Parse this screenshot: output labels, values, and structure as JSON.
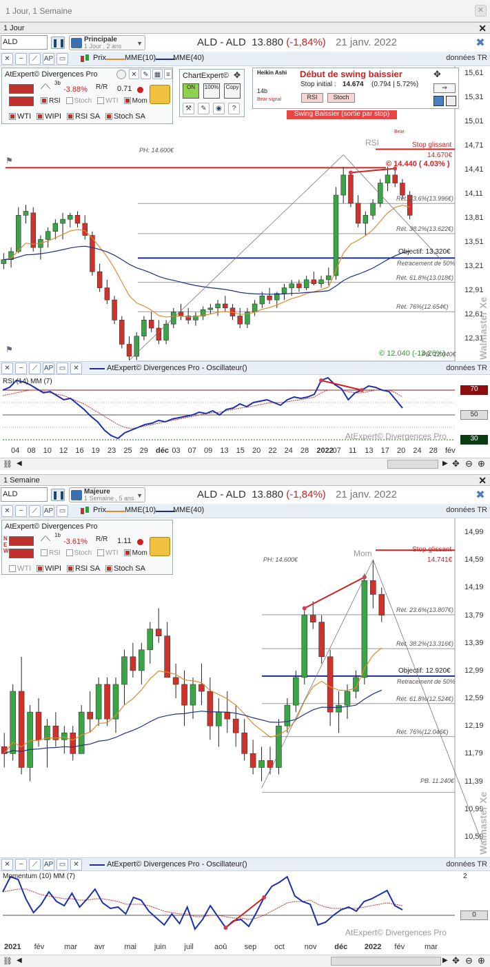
{
  "window": {
    "tab_title": "1 Jour, 1 Semaine"
  },
  "common": {
    "ticker": "ALD",
    "title_name": "ALD - ALD",
    "price": "13.880",
    "change": "(-1,84%)",
    "date": "21 janv. 2022",
    "prix_label": "Prix",
    "dtr_label": "données TR",
    "mme10_label": "MME(10)",
    "mme40_label": "MME(40)",
    "osc_name": "AtExpert© Divergences Pro - Oscillateur()",
    "watermark": "Walmaster Xe",
    "atexpert_wm": "AtExpert© Divergences Pro",
    "stop_label": "Stop glissant",
    "objectif_label": "Retracement de 50%",
    "panel_title": "AtExpert© Divergences Pro"
  },
  "daily": {
    "pane_label": "1 Jour",
    "selector_main": "Principale",
    "selector_sub": "1 Jour , 2 ans",
    "panel_pct": "-3.88%",
    "panel_ratio": "0.71",
    "panel_period": "3b",
    "checks": [
      {
        "label": "RSI",
        "on": true
      },
      {
        "label": "Stoch",
        "on": false
      },
      {
        "label": "WTI",
        "on": false
      },
      {
        "label": "Mom",
        "on": true
      }
    ],
    "sa_checks": [
      {
        "label": "WTI",
        "on": true
      },
      {
        "label": "WIPI",
        "on": true
      },
      {
        "label": "RSI SA",
        "on": true
      },
      {
        "label": "Stoch SA",
        "on": true
      }
    ],
    "chartexpert": "ChartExpert©",
    "ce_buttons": [
      "ON",
      "100%",
      "Copy"
    ],
    "signal": {
      "heikin": "Heikin Ashi",
      "bars": "14b",
      "bear_signal": "Bear signal",
      "title": "Début de swing baissier",
      "stop_init_label": "Stop initial :",
      "stop_init": "14.674",
      "stop_detail": "(0.794 | 5.72%)",
      "rsi_btn": "RSI",
      "stoch_btn": "Stoch",
      "banner": "Swing Baissier (sortie par stop)",
      "bear": "Bear"
    },
    "ph": "PH: 14.600€",
    "rsi_label": "RSI",
    "stop_value": "14.670€",
    "level": "© 14.440 ( 4.03% )",
    "pb": "© 12.040 (-13.26%)",
    "pb2": "PB. 12.040€",
    "objectif": "Objectif: 13,320€",
    "fibs": [
      {
        "label": "Rét. 23.6%(13.996€)",
        "v": 13.996
      },
      {
        "label": "Rét. 38.2%(13.622€)",
        "v": 13.622
      },
      {
        "label": "Rét. 61.8%(13.018€)",
        "v": 13.018
      },
      {
        "label": "Rét. 76%(12.654€)",
        "v": 12.654
      }
    ],
    "osc_title": "RSI (14) MM (7)",
    "osc_levels": [
      "70",
      "50",
      "30"
    ],
    "chart_data": {
      "type": "line",
      "title": "ALD - ALD 1 Jour",
      "ylim": [
        12.04,
        15.7
      ],
      "yticks": [
        "15,61",
        "15,31",
        "15,01",
        "14,71",
        "14,41",
        "14,11",
        "13,81",
        "13,51",
        "13,21",
        "12,91",
        "12,61",
        "12,31"
      ],
      "xticks": [
        "04",
        "08",
        "10",
        "12",
        "16",
        "19",
        "23",
        "25",
        "29",
        "déc",
        "03",
        "07",
        "09",
        "13",
        "15",
        "20",
        "22",
        "24",
        "28",
        "2022",
        "07",
        "11",
        "13",
        "17",
        "20",
        "24",
        "28",
        "fév"
      ],
      "candles": [
        [
          13.25,
          13.38,
          13.18,
          13.3
        ],
        [
          13.3,
          13.45,
          13.2,
          13.4
        ],
        [
          13.4,
          13.95,
          13.38,
          13.85
        ],
        [
          13.85,
          13.98,
          13.75,
          13.9
        ],
        [
          13.88,
          13.95,
          13.4,
          13.45
        ],
        [
          13.45,
          13.6,
          13.3,
          13.55
        ],
        [
          13.55,
          13.7,
          13.45,
          13.65
        ],
        [
          13.65,
          13.8,
          13.55,
          13.75
        ],
        [
          13.75,
          13.88,
          13.55,
          13.8
        ],
        [
          13.8,
          13.88,
          13.7,
          13.85
        ],
        [
          13.85,
          13.9,
          13.7,
          13.75
        ],
        [
          13.75,
          13.85,
          13.55,
          13.6
        ],
        [
          13.6,
          13.65,
          13.1,
          13.15
        ],
        [
          13.15,
          13.25,
          12.9,
          12.95
        ],
        [
          12.95,
          13.05,
          12.75,
          12.8
        ],
        [
          12.8,
          12.85,
          12.5,
          12.55
        ],
        [
          12.55,
          12.6,
          12.2,
          12.25
        ],
        [
          12.25,
          12.35,
          12.05,
          12.1
        ],
        [
          12.1,
          12.4,
          12.05,
          12.35
        ],
        [
          12.35,
          12.6,
          12.3,
          12.55
        ],
        [
          12.55,
          12.65,
          12.4,
          12.45
        ],
        [
          12.45,
          12.55,
          12.25,
          12.3
        ],
        [
          12.3,
          12.55,
          12.25,
          12.5
        ],
        [
          12.5,
          12.7,
          12.45,
          12.65
        ],
        [
          12.65,
          12.75,
          12.55,
          12.6
        ],
        [
          12.6,
          12.7,
          12.5,
          12.55
        ],
        [
          12.55,
          12.65,
          12.48,
          12.6
        ],
        [
          12.6,
          12.72,
          12.55,
          12.68
        ],
        [
          12.68,
          12.75,
          12.62,
          12.7
        ],
        [
          12.7,
          12.8,
          12.6,
          12.75
        ],
        [
          12.75,
          12.85,
          12.65,
          12.7
        ],
        [
          12.7,
          12.75,
          12.55,
          12.6
        ],
        [
          12.6,
          12.7,
          12.45,
          12.5
        ],
        [
          12.5,
          12.7,
          12.45,
          12.65
        ],
        [
          12.65,
          12.8,
          12.6,
          12.75
        ],
        [
          12.75,
          12.9,
          12.7,
          12.85
        ],
        [
          12.85,
          12.95,
          12.75,
          12.8
        ],
        [
          12.8,
          12.9,
          12.7,
          12.88
        ],
        [
          12.88,
          13.0,
          12.8,
          12.95
        ],
        [
          12.95,
          13.05,
          12.85,
          13.0
        ],
        [
          13.0,
          13.05,
          12.9,
          12.95
        ],
        [
          12.95,
          13.1,
          12.92,
          13.05
        ],
        [
          13.05,
          13.15,
          12.98,
          13.0
        ],
        [
          13.0,
          13.1,
          12.95,
          13.05
        ],
        [
          13.05,
          13.2,
          12.98,
          13.1
        ],
        [
          13.1,
          14.2,
          13.05,
          14.1
        ],
        [
          14.1,
          14.45,
          14.0,
          14.35
        ],
        [
          14.35,
          14.4,
          13.95,
          14.0
        ],
        [
          14.0,
          14.1,
          13.7,
          13.75
        ],
        [
          13.75,
          13.9,
          13.6,
          13.85
        ],
        [
          13.85,
          14.05,
          13.8,
          14.0
        ],
        [
          14.0,
          14.3,
          13.95,
          14.25
        ],
        [
          14.25,
          14.45,
          14.15,
          14.35
        ],
        [
          14.35,
          14.45,
          14.2,
          14.25
        ],
        [
          14.25,
          14.3,
          14.05,
          14.1
        ],
        [
          14.1,
          14.15,
          13.8,
          13.85
        ]
      ],
      "series": [
        {
          "name": "MME(10)",
          "color": "#e28a2a"
        },
        {
          "name": "MME(40)",
          "color": "#1a2f8a"
        }
      ]
    }
  },
  "weekly": {
    "pane_label": "1 Semaine",
    "selector_main": "Majeure",
    "selector_sub": "1 Semaine , 5 ans",
    "panel_pct": "-3.61%",
    "panel_ratio": "1.11",
    "panel_period": "1b",
    "checks": [
      {
        "label": "RSI",
        "on": false
      },
      {
        "label": "Stoch",
        "on": false
      },
      {
        "label": "WTI",
        "on": false
      },
      {
        "label": "Mom",
        "on": true
      }
    ],
    "sa_checks": [
      {
        "label": "WTI",
        "on": false
      },
      {
        "label": "WIPI",
        "on": true
      },
      {
        "label": "RSI SA",
        "on": true
      },
      {
        "label": "Stoch SA",
        "on": true
      }
    ],
    "ph": "PH: 14.600€",
    "mom_label": "Mom",
    "stop_value": "14.741€",
    "objectif": "Objectif: 12.920€",
    "pb": "PB. 11.240€",
    "fibs": [
      {
        "label": "Rét. 23.6%(13.807€)",
        "v": 13.807
      },
      {
        "label": "Rét. 38.2%(13.316€)",
        "v": 13.316
      },
      {
        "label": "Rét. 61.8%(12.524€)",
        "v": 12.524
      },
      {
        "label": "Rét. 76%(12.046€)",
        "v": 12.046
      }
    ],
    "osc_title": "Momentum (10) MM (7)",
    "osc_levels": [
      "2",
      "0"
    ],
    "chart_data": {
      "type": "line",
      "title": "ALD - ALD 1 Semaine",
      "ylim": [
        10.3,
        15.2
      ],
      "yticks": [
        "14,99",
        "14,59",
        "14,19",
        "13,79",
        "13,39",
        "12,99",
        "12,59",
        "12,19",
        "11,79",
        "11,39",
        "10,99",
        "10,59"
      ],
      "xticks": [
        "2021",
        "fév",
        "mar",
        "avr",
        "mai",
        "juin",
        "juil",
        "aoû",
        "sep",
        "oct",
        "nov",
        "déc",
        "2022",
        "fév",
        "mar"
      ],
      "candles": [
        [
          11.9,
          12.1,
          11.6,
          11.8
        ],
        [
          11.8,
          12.8,
          11.7,
          12.7
        ],
        [
          12.7,
          13.2,
          11.5,
          11.6
        ],
        [
          11.6,
          12.5,
          11.4,
          12.4
        ],
        [
          12.4,
          12.6,
          11.9,
          12.0
        ],
        [
          12.0,
          12.3,
          11.6,
          12.2
        ],
        [
          12.2,
          12.4,
          11.9,
          12.0
        ],
        [
          12.0,
          12.2,
          11.8,
          12.1
        ],
        [
          12.1,
          12.2,
          11.7,
          11.8
        ],
        [
          11.8,
          12.5,
          11.8,
          12.4
        ],
        [
          12.4,
          12.7,
          12.1,
          12.3
        ],
        [
          12.3,
          12.9,
          12.2,
          12.8
        ],
        [
          12.8,
          12.9,
          12.2,
          12.3
        ],
        [
          12.3,
          12.9,
          12.1,
          12.8
        ],
        [
          12.8,
          13.3,
          12.5,
          13.2
        ],
        [
          13.2,
          13.4,
          12.9,
          13.0
        ],
        [
          13.0,
          13.4,
          12.8,
          13.3
        ],
        [
          13.3,
          13.7,
          13.1,
          13.6
        ],
        [
          13.6,
          13.9,
          13.4,
          13.5
        ],
        [
          13.5,
          13.7,
          13.1,
          12.9
        ],
        [
          12.9,
          13.1,
          12.6,
          12.8
        ],
        [
          12.8,
          13.0,
          12.2,
          12.5
        ],
        [
          12.5,
          12.9,
          12.3,
          12.8
        ],
        [
          12.8,
          13.1,
          12.5,
          12.7
        ],
        [
          12.7,
          12.9,
          12.0,
          12.2
        ],
        [
          12.2,
          12.6,
          11.9,
          12.4
        ],
        [
          12.4,
          12.7,
          12.1,
          12.3
        ],
        [
          12.3,
          12.5,
          11.9,
          12.1
        ],
        [
          12.1,
          12.3,
          11.7,
          11.8
        ],
        [
          11.8,
          12.0,
          11.5,
          11.6
        ],
        [
          11.6,
          11.9,
          11.4,
          11.7
        ],
        [
          11.7,
          11.9,
          11.5,
          11.6
        ],
        [
          11.6,
          12.3,
          11.5,
          12.2
        ],
        [
          12.2,
          12.6,
          12.1,
          12.5
        ],
        [
          12.5,
          13.0,
          12.4,
          12.9
        ],
        [
          12.9,
          13.9,
          12.8,
          13.8
        ],
        [
          13.8,
          14.0,
          13.6,
          13.7
        ],
        [
          13.7,
          13.8,
          13.1,
          13.2
        ],
        [
          13.2,
          13.3,
          12.2,
          12.4
        ],
        [
          12.4,
          12.7,
          12.1,
          12.5
        ],
        [
          12.5,
          12.8,
          12.3,
          12.7
        ],
        [
          12.7,
          13.0,
          12.6,
          12.9
        ],
        [
          12.9,
          14.4,
          12.8,
          14.3
        ],
        [
          14.3,
          14.6,
          13.9,
          14.1
        ],
        [
          14.1,
          14.2,
          13.7,
          13.8
        ]
      ],
      "series": [
        {
          "name": "MME(10)",
          "color": "#e28a2a"
        },
        {
          "name": "MME(40)",
          "color": "#1a2f8a"
        }
      ]
    }
  }
}
